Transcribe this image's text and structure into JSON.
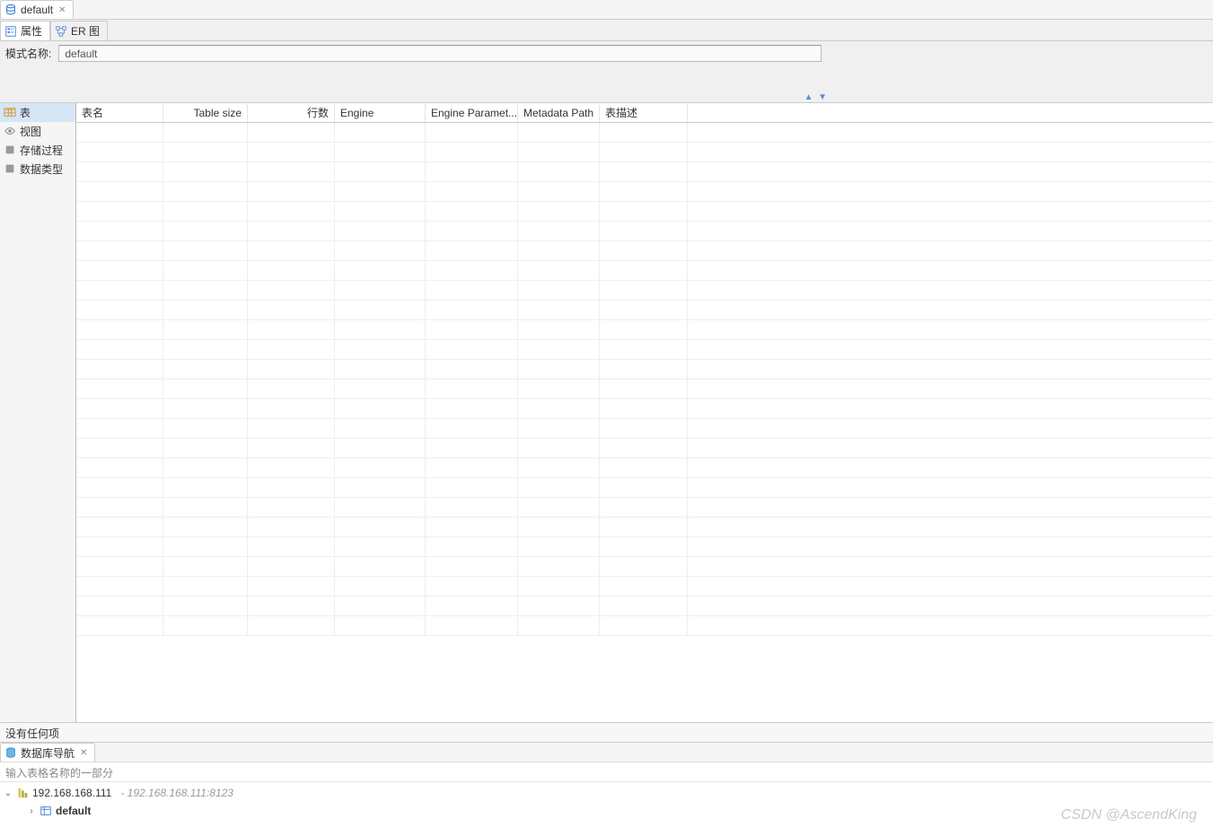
{
  "topTab": {
    "label": "default"
  },
  "subTabs": {
    "properties": "属性",
    "erDiagram": "ER 图"
  },
  "schema": {
    "label": "模式名称:",
    "value": "default"
  },
  "sidebar": {
    "items": [
      {
        "label": "表"
      },
      {
        "label": "视图"
      },
      {
        "label": "存储过程"
      },
      {
        "label": "数据类型"
      }
    ]
  },
  "table": {
    "headers": {
      "name": "表名",
      "size": "Table size",
      "rows": "行数",
      "engine": "Engine",
      "engineParams": "Engine Paramet...",
      "metadataPath": "Metadata Path",
      "desc": "表描述"
    }
  },
  "status": "没有任何项",
  "nav": {
    "title": "数据库导航",
    "filterPlaceholder": "输入表格名称的一部分",
    "connection": {
      "host": "192.168.168.111",
      "detail": "- 192.168.168.111:8123"
    },
    "schema": "default"
  },
  "watermark": "CSDN @AscendKing"
}
